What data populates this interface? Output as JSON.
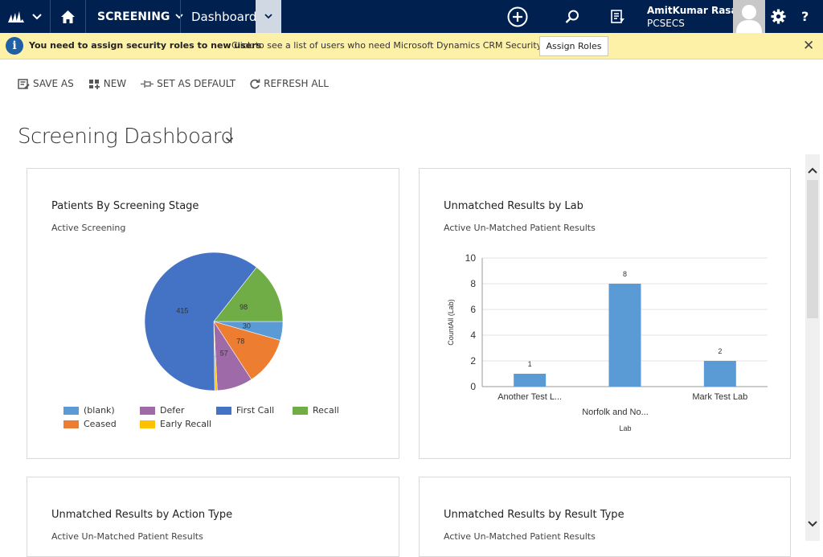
{
  "topbar": {
    "module": "SCREENING",
    "area": "Dashboards",
    "user_name": "AmitKumar Rasal",
    "user_org": "PCSECS",
    "help": "?"
  },
  "notification": {
    "title": "You need to assign security roles to new users",
    "detail": "Click to see a list of users who need Microsoft Dynamics CRM Security Roles.",
    "button": "Assign Roles",
    "close": "✕"
  },
  "commands": [
    {
      "label": "SAVE AS",
      "icon": "save-as-icon"
    },
    {
      "label": "NEW",
      "icon": "new-icon"
    },
    {
      "label": "SET AS DEFAULT",
      "icon": "pin-icon"
    },
    {
      "label": "REFRESH ALL",
      "icon": "refresh-icon"
    }
  ],
  "dashboard": {
    "title": "Screening Dashboard"
  },
  "cards": [
    {
      "title": "Patients By Screening Stage",
      "subtitle": "Active Screening"
    },
    {
      "title": "Unmatched Results by Lab",
      "subtitle": "Active Un-Matched Patient Results"
    },
    {
      "title": "Unmatched Results by Action Type",
      "subtitle": "Active Un-Matched Patient Results"
    },
    {
      "title": "Unmatched Results by Result Type",
      "subtitle": "Active Un-Matched Patient Results"
    }
  ],
  "chart_data": [
    {
      "type": "pie",
      "title": "Patients By Screening Stage",
      "subtitle": "Active Screening",
      "slices": [
        {
          "name": "First Call",
          "value": 415,
          "color": "#4472c4"
        },
        {
          "name": "Recall",
          "value": 98,
          "color": "#70ad47"
        },
        {
          "name": "(blank)",
          "value": 30,
          "color": "#5b9bd5"
        },
        {
          "name": "Ceased",
          "value": 78,
          "color": "#ed7d31"
        },
        {
          "name": "Defer",
          "value": 57,
          "color": "#9e6ba8"
        },
        {
          "name": "Early Recall",
          "value": 4,
          "color": "#ffc000"
        }
      ],
      "legend": [
        {
          "name": "(blank)",
          "color": "#5b9bd5"
        },
        {
          "name": "Defer",
          "color": "#9e6ba8"
        },
        {
          "name": "First Call",
          "color": "#4472c4"
        },
        {
          "name": "Recall",
          "color": "#70ad47"
        },
        {
          "name": "Ceased",
          "color": "#ed7d31"
        },
        {
          "name": "Early Recall",
          "color": "#ffc000"
        }
      ],
      "legend_position": "bottom"
    },
    {
      "type": "bar",
      "title": "Unmatched Results by Lab",
      "subtitle": "Active Un-Matched Patient Results",
      "categories": [
        "Another Test L...",
        "Norfolk and No...",
        "Mark Test Lab"
      ],
      "values": [
        1,
        8,
        2
      ],
      "xlabel": "Lab",
      "ylabel": "CountAll (Lab)",
      "ylim": [
        0,
        10
      ],
      "yticks": [
        0,
        2,
        4,
        6,
        8,
        10
      ],
      "color": "#5b9bd5",
      "grid": true
    }
  ]
}
